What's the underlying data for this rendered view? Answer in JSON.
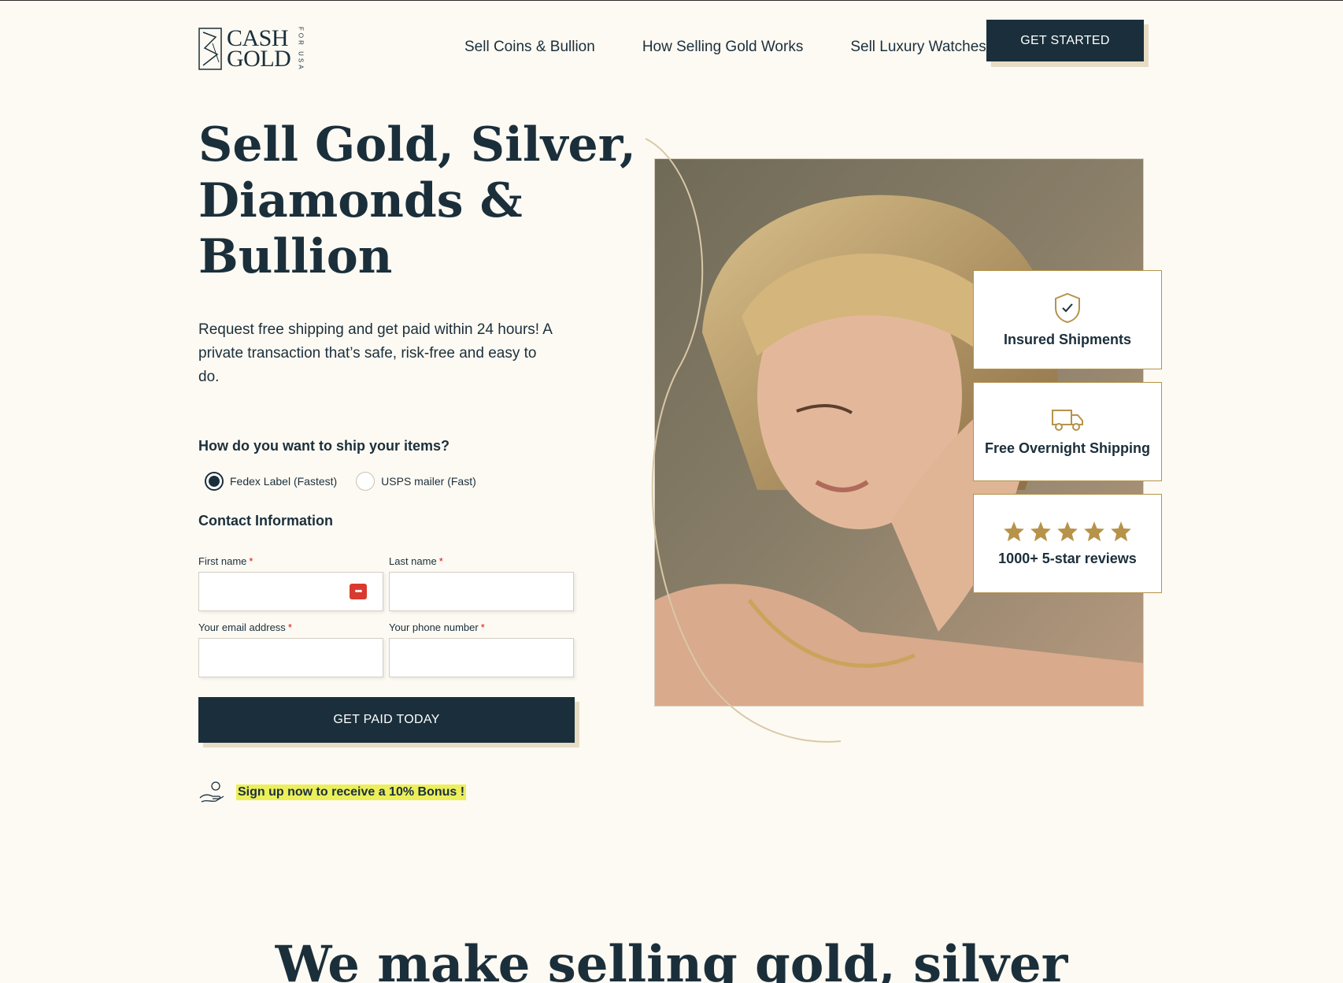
{
  "brand": {
    "top": "CASH",
    "bottom": "GOLD",
    "side": "FOR USA"
  },
  "nav": {
    "items": [
      "Sell Coins & Bullion",
      "How Selling Gold Works",
      "Sell Luxury Watches"
    ],
    "cta": "GET STARTED"
  },
  "hero": {
    "title": "Sell Gold, Silver, Diamonds & Bullion",
    "subtitle": "Request free shipping and get paid within 24 hours! A private transaction that’s safe, risk-free and easy to do."
  },
  "form": {
    "ship_question": "How do you want to ship your items?",
    "ship_options": [
      {
        "label": "Fedex Label (Fastest)",
        "selected": true
      },
      {
        "label": "USPS mailer (Fast)",
        "selected": false
      }
    ],
    "contact_heading": "Contact Information",
    "fields": {
      "first_name": {
        "label": "First name",
        "required_mark": "*",
        "value": ""
      },
      "last_name": {
        "label": "Last name",
        "required_mark": "*",
        "value": ""
      },
      "email": {
        "label": "Your email address",
        "required_mark": "*",
        "value": ""
      },
      "phone": {
        "label": "Your phone number",
        "required_mark": "*",
        "value": ""
      }
    },
    "password_manager_icon": "•••",
    "submit": "GET PAID TODAY",
    "bonus": "Sign up now to receive a 10% Bonus !"
  },
  "badges": {
    "insured": "Insured Shipments",
    "shipping": "Free Overnight Shipping",
    "reviews": "1000+ 5-star reviews",
    "review_stars": 5
  },
  "section": {
    "heading": "We make selling gold, silver"
  },
  "colors": {
    "navy": "#1a2f3b",
    "gold": "#b69349",
    "background": "#fdfaf3",
    "highlight": "#ecef5a"
  }
}
